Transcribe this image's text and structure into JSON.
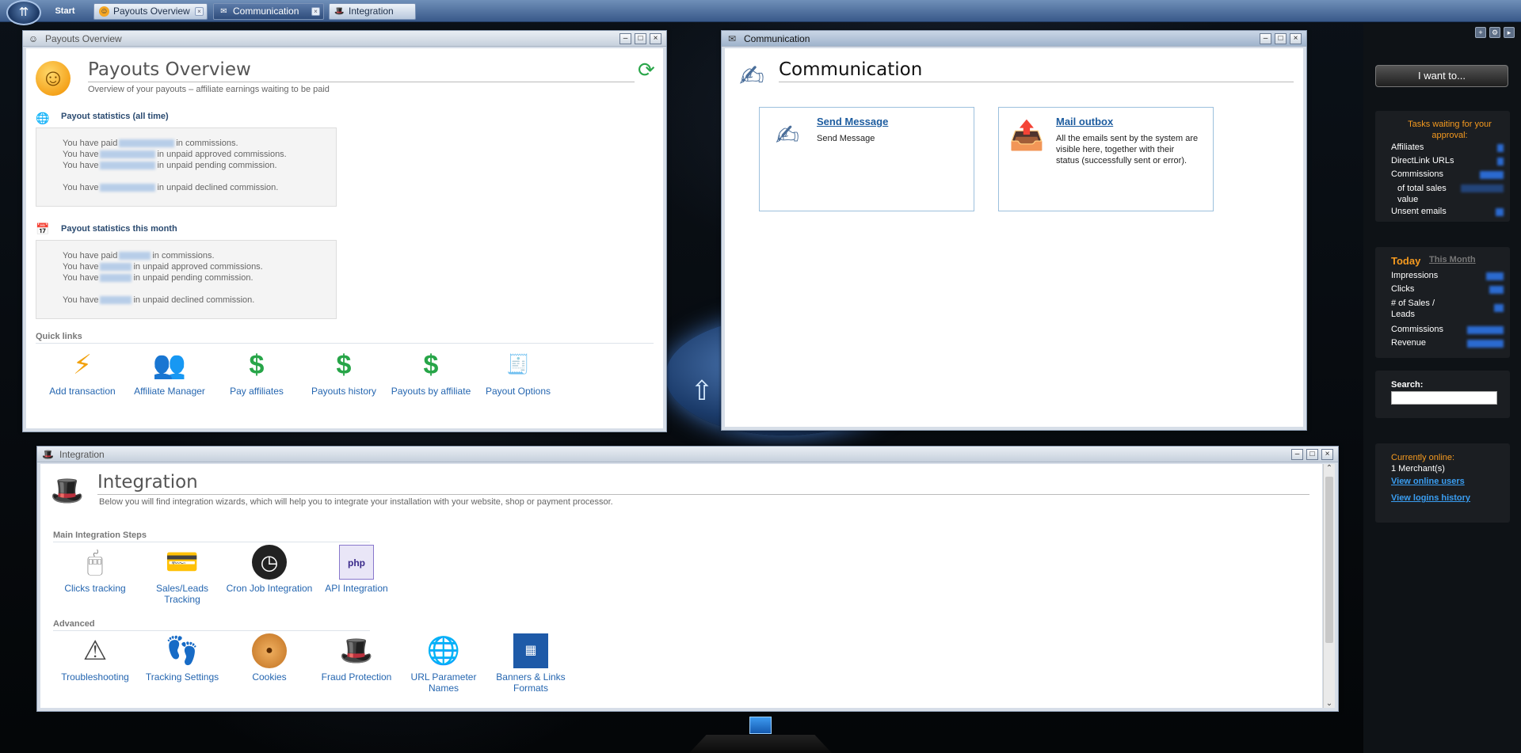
{
  "taskbar": {
    "start": "Start",
    "tabs": [
      "Payouts Overview",
      "Communication",
      "Integration"
    ]
  },
  "payouts": {
    "window_title": "Payouts Overview",
    "title": "Payouts Overview",
    "subtitle": "Overview of your payouts – affiliate earnings waiting to be paid",
    "all_time": {
      "heading": "Payout statistics (all time)",
      "lines": [
        {
          "pre": "You have paid",
          "post": "in commissions."
        },
        {
          "pre": "You have",
          "post": "in unpaid approved commissions."
        },
        {
          "pre": "You have",
          "post": "in unpaid pending commission."
        },
        {
          "pre": "You have",
          "post": "in unpaid declined commission."
        }
      ]
    },
    "this_month": {
      "heading": "Payout statistics this month",
      "lines": [
        {
          "pre": "You have paid",
          "post": "in commissions."
        },
        {
          "pre": "You have",
          "post": "in unpaid approved commissions."
        },
        {
          "pre": "You have",
          "post": "in unpaid pending commission."
        },
        {
          "pre": "You have",
          "post": "in unpaid declined commission."
        }
      ]
    },
    "quick_links_head": "Quick links",
    "quick_links": [
      {
        "label": "Add transaction",
        "icon": "lightning-icon"
      },
      {
        "label": "Affiliate Manager",
        "icon": "affiliate-manager-icon"
      },
      {
        "label": "Pay affiliates",
        "icon": "pay-affiliates-icon"
      },
      {
        "label": "Payouts history",
        "icon": "payouts-history-icon"
      },
      {
        "label": "Payouts by affiliate",
        "icon": "payouts-by-affiliate-icon"
      },
      {
        "label": "Payout Options",
        "icon": "payout-options-icon"
      }
    ]
  },
  "communication": {
    "window_title": "Communication",
    "title": "Communication",
    "cards": [
      {
        "title": "Send Message",
        "desc": "Send Message"
      },
      {
        "title": "Mail outbox",
        "desc": "All the emails sent by the system are visible here, together with their status (successfully sent or error)."
      }
    ]
  },
  "integration": {
    "window_title": "Integration",
    "title": "Integration",
    "subtitle": "Below you will find integration wizards, which will help you to integrate your installation with your website, shop or payment processor.",
    "main_head": "Main Integration Steps",
    "main_items": [
      {
        "label": "Clicks tracking",
        "icon": "mouse-icon"
      },
      {
        "label": "Sales/Leads Tracking",
        "icon": "sales-leads-icon"
      },
      {
        "label": "Cron Job Integration",
        "icon": "clock-icon"
      },
      {
        "label": "API Integration",
        "icon": "php-icon"
      }
    ],
    "adv_head": "Advanced",
    "adv_items": [
      {
        "label": "Troubleshooting",
        "icon": "warning-icon"
      },
      {
        "label": "Tracking Settings",
        "icon": "footprints-icon"
      },
      {
        "label": "Cookies",
        "icon": "cookie-icon"
      },
      {
        "label": "Fraud Protection",
        "icon": "detective-hat-icon"
      },
      {
        "label": "URL Parameter Names",
        "icon": "link-globe-icon"
      },
      {
        "label": "Banners & Links Formats",
        "icon": "banners-icon"
      }
    ]
  },
  "sidebar": {
    "iwant": "I want to...",
    "tasks_head": "Tasks waiting for your approval:",
    "tasks": [
      "Affiliates",
      "DirectLink URLs",
      "Commissions",
      "of total sales value",
      "Unsent emails"
    ],
    "today": "Today",
    "this_month": "This Month",
    "today_rows": [
      "Impressions",
      "Clicks",
      "# of Sales / Leads",
      "Commissions",
      "Revenue"
    ],
    "search_label": "Search:",
    "online_head": "Currently online:",
    "online_count": "1  Merchant(s)",
    "view_online": "View online users",
    "view_logins": "View logins history"
  },
  "colors": {
    "link": "#2566b0",
    "accent_orange": "#f59a1f",
    "sidebar_link": "#3a9ef2"
  }
}
